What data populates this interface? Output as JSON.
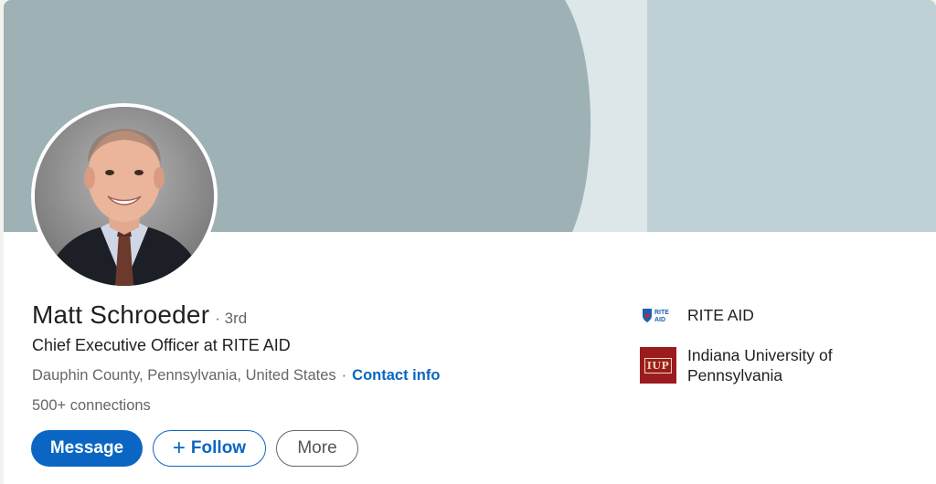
{
  "profile": {
    "name": "Matt Schroeder",
    "degree": "· 3rd",
    "headline": "Chief Executive Officer at RITE AID",
    "location": "Dauphin County, Pennsylvania, United States",
    "separator": "·",
    "contact_label": "Contact info",
    "connections": "500+ connections"
  },
  "actions": {
    "message_label": "Message",
    "follow_label": "Follow",
    "follow_icon": "+",
    "more_label": "More"
  },
  "organizations": [
    {
      "name": "RITE AID",
      "logo": "rite-aid-logo",
      "logo_text": "RITE AID"
    },
    {
      "name": "Indiana University of Pennsylvania",
      "logo": "iup-logo",
      "logo_text": "IUP"
    }
  ],
  "colors": {
    "primary": "#0a66c2",
    "banner_dark": "#9eb1b5",
    "banner_light": "#bfd1d5",
    "banner_gap": "#dde6e9",
    "iup_red": "#9b1c1f"
  }
}
